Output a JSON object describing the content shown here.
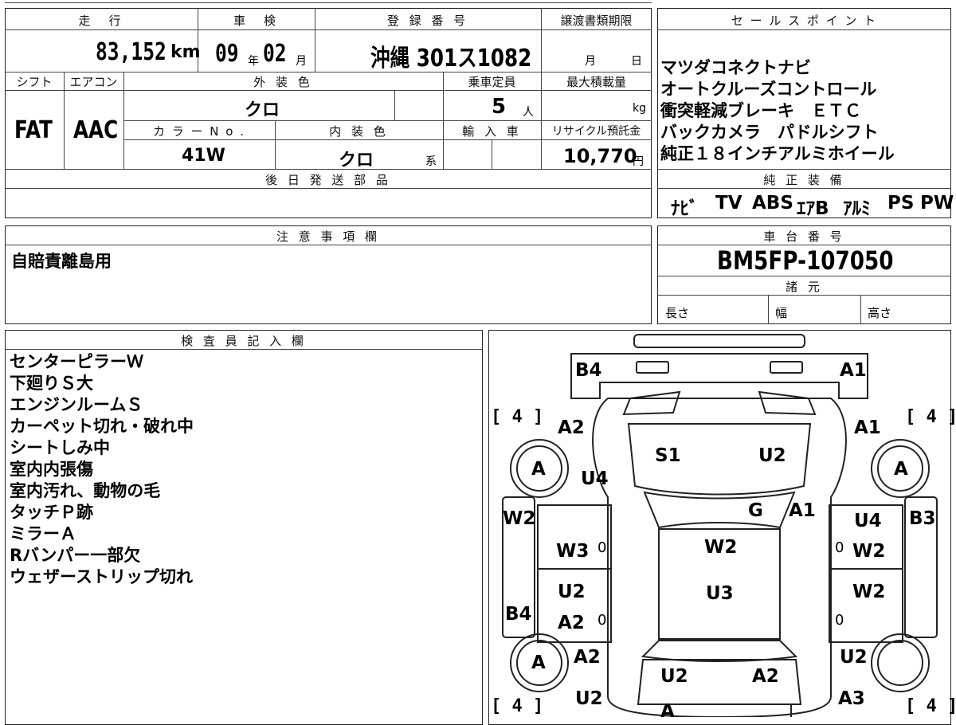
{
  "top_info": {
    "headers": {
      "mileage": "走　行",
      "inspection": "車　検",
      "registration": "登 録 番 号",
      "transfer_deadline": "譲渡書類期限",
      "shift": "シフト",
      "aircon": "エアコン",
      "exterior_color": "外 装 色",
      "capacity": "乗車定員",
      "max_load": "最大積載量",
      "color_no": "カ ラ ー N o .",
      "interior_color": "内 装 色",
      "import": "輸 入 車",
      "recycle": "リサイクル預託金",
      "later_parts": "後 日 発 送 部 品"
    },
    "mileage_value": "83,152",
    "mileage_unit": "km",
    "inspection_year": "09",
    "inspection_year_unit": "年",
    "inspection_month": "02",
    "inspection_month_unit": "月",
    "registration_value": "沖縄 301ス1082",
    "transfer_month_unit": "月",
    "transfer_day_unit": "日",
    "shift_value": "FAT",
    "aircon_value": "AAC",
    "exterior_color_value": "クロ",
    "capacity_value": "5",
    "capacity_unit": "人",
    "max_load_unit": "kg",
    "color_no_value": "41W",
    "interior_color_value": "クロ",
    "interior_color_suffix": "系",
    "recycle_value": "10,770",
    "recycle_unit": "円"
  },
  "sales_points": {
    "header": "セ ー ル ス ポ イ ン ト",
    "lines": [
      "マツダコネクトナビ",
      "オートクルーズコントロール",
      "衝突軽減ブレーキ　ＥＴＣ",
      "バックカメラ　パドルシフト",
      "純正１８インチアルミホイール"
    ]
  },
  "factory_equipment": {
    "header": "純 正 装 備",
    "items": [
      "ﾅﾋﾞ",
      "TV",
      "ABS",
      "ｴｱB",
      "ｱﾙﾐ",
      "PS",
      "PW"
    ]
  },
  "notes": {
    "header": "注 意 事 項 欄",
    "text": "自賠責離島用"
  },
  "chassis": {
    "header": "車 台 番 号",
    "number": "BM5FP-107050",
    "spec_header": "諸 元",
    "length_label": "長さ",
    "width_label": "幅",
    "height_label": "高さ"
  },
  "inspector": {
    "header": "検 査 員 記 入 欄",
    "lines": [
      "センターピラーＷ",
      "下廻りＳ大",
      "エンジンルームＳ",
      "カーペット切れ・破れ中",
      "シートしみ中",
      "室内内張傷",
      "室内汚れ、動物の毛",
      "タッチＰ跡",
      "ミラーＡ",
      "Rバンパー一部欠",
      "ウェザーストリップ切れ"
    ]
  },
  "diagram": {
    "brackets": {
      "front_left": "[ 4 ]",
      "front_right": "[ 4 ]",
      "rear_left": "[ 4 ]",
      "rear_right": "[ 4 ]"
    },
    "codes": {
      "b4_top": "B4",
      "a1_top": "A1",
      "a2_left_front": "A2",
      "a1_right_front": "A1",
      "s1": "S1",
      "u2_hood": "U2",
      "u4_left": "U4",
      "tire_fl": "A",
      "tire_fr": "A",
      "g_windshield": "G",
      "a1_pillar": "A1",
      "w2_left_fender": "W2",
      "u4_right": "U4",
      "b3_right": "B3",
      "w3_left_door": "W3",
      "w2_roof": "W2",
      "w2_right_door": "W2",
      "u2_left_rear_door": "U2",
      "u3_roof": "U3",
      "w2_right_rear": "W2",
      "b4_left": "B4",
      "a2_left_rear_door": "A2",
      "tire_rl": "A",
      "a2_left_rear": "A2",
      "u2_right_rear": "U2",
      "u2_trunk_left": "U2",
      "a2_trunk_right": "A2",
      "u2_bottom_left": "U2",
      "a3_bottom_right": "A3",
      "a_bottom": "A",
      "zero_1": "0",
      "zero_2": "0",
      "zero_3": "0",
      "zero_4": "0"
    }
  }
}
